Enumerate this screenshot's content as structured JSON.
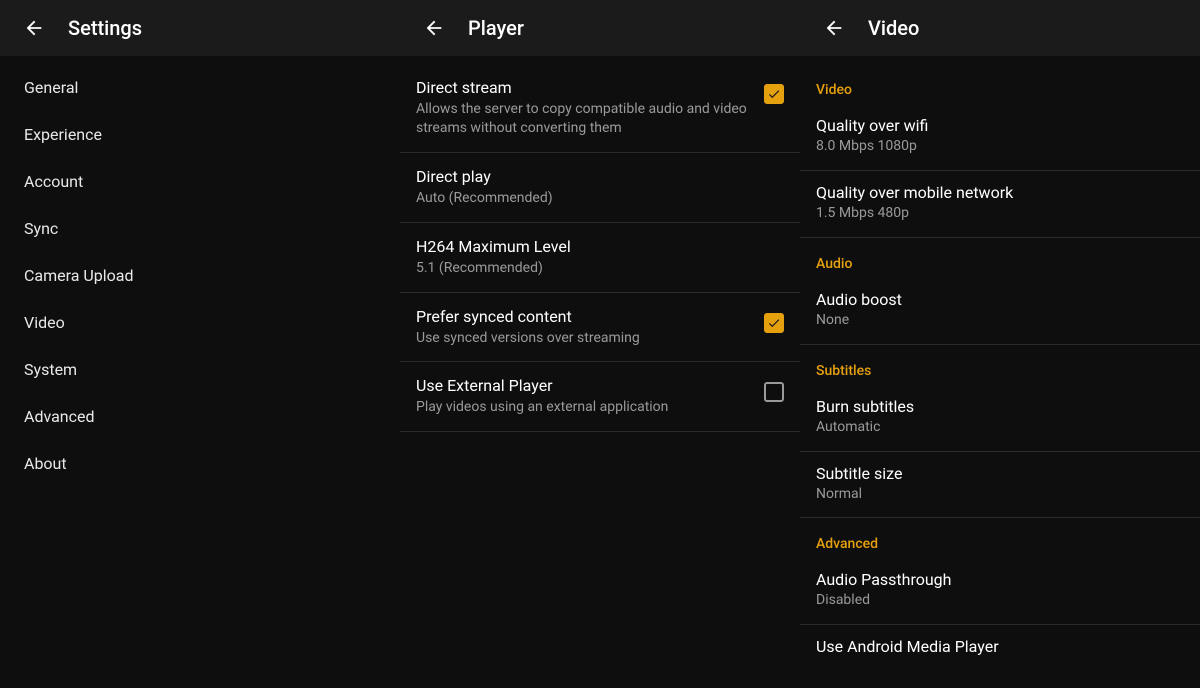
{
  "accent": "#e5a00d",
  "panels": {
    "settings": {
      "title": "Settings",
      "items": [
        "General",
        "Experience",
        "Account",
        "Sync",
        "Camera Upload",
        "Video",
        "System",
        "Advanced",
        "About"
      ]
    },
    "player": {
      "title": "Player",
      "rows": [
        {
          "title": "Direct stream",
          "sub": "Allows the server to copy compatible audio and video streams without converting them",
          "checkbox": true,
          "checked": true
        },
        {
          "title": "Direct play",
          "sub": "Auto (Recommended)",
          "checkbox": false
        },
        {
          "title": "H264 Maximum Level",
          "sub": "5.1 (Recommended)",
          "checkbox": false
        },
        {
          "title": "Prefer synced content",
          "sub": "Use synced versions over streaming",
          "checkbox": true,
          "checked": true
        },
        {
          "title": "Use External Player",
          "sub": "Play videos using an external application",
          "checkbox": true,
          "checked": false
        }
      ]
    },
    "video": {
      "title": "Video",
      "sections": [
        {
          "header": "Video",
          "rows": [
            {
              "title": "Quality over wifi",
              "sub": "8.0 Mbps 1080p"
            },
            {
              "title": "Quality over mobile network",
              "sub": "1.5 Mbps 480p"
            }
          ]
        },
        {
          "header": "Audio",
          "rows": [
            {
              "title": "Audio boost",
              "sub": "None"
            }
          ]
        },
        {
          "header": "Subtitles",
          "rows": [
            {
              "title": "Burn subtitles",
              "sub": "Automatic"
            },
            {
              "title": "Subtitle size",
              "sub": "Normal"
            }
          ]
        },
        {
          "header": "Advanced",
          "rows": [
            {
              "title": "Audio Passthrough",
              "sub": "Disabled"
            },
            {
              "title": "Use Android Media Player",
              "sub": ""
            }
          ]
        }
      ]
    }
  }
}
